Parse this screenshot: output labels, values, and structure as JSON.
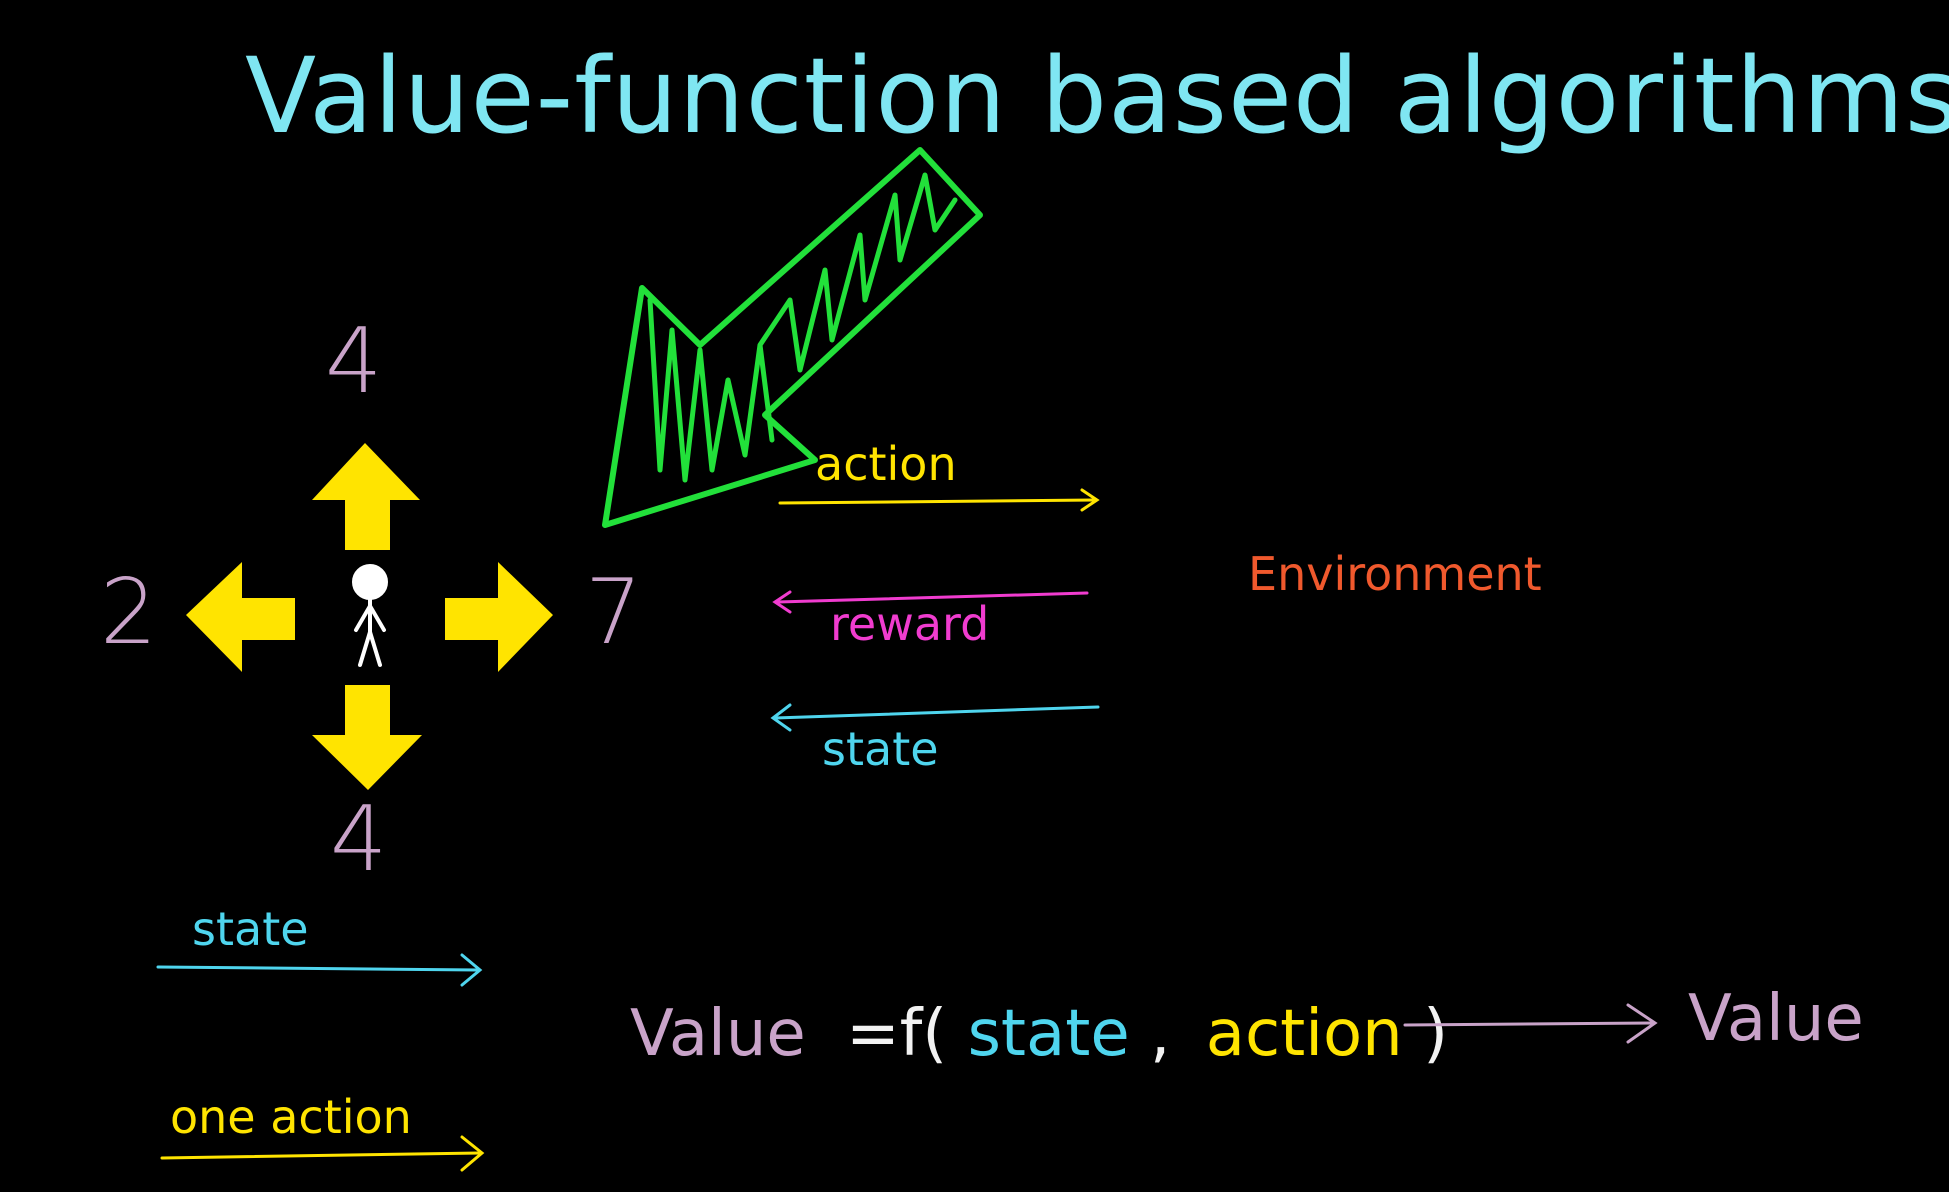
{
  "title": "Value-function based algorithms",
  "agent": {
    "up_value": "4",
    "down_value": "4",
    "left_value": "2",
    "right_value": "7"
  },
  "loop": {
    "action_label": "action",
    "reward_label": "reward",
    "state_label": "state",
    "environment_label": "Environment"
  },
  "legend": {
    "state_label": "state",
    "one_action_label": "one action"
  },
  "equation": {
    "lhs": "Value",
    "equals_f": "=f(",
    "state": "state",
    "comma": ",",
    "action": "action",
    "close": ")",
    "output": "Value"
  },
  "colors": {
    "title": "#7fe6f2",
    "arrow_yellow": "#ffe400",
    "pointer_green": "#22e03a",
    "number_purple": "#c9a3c9",
    "reward_magenta": "#f03ccf",
    "state_cyan": "#4fd5ee",
    "environment_orange": "#f0592d",
    "equation_white": "#f2f2f2"
  }
}
